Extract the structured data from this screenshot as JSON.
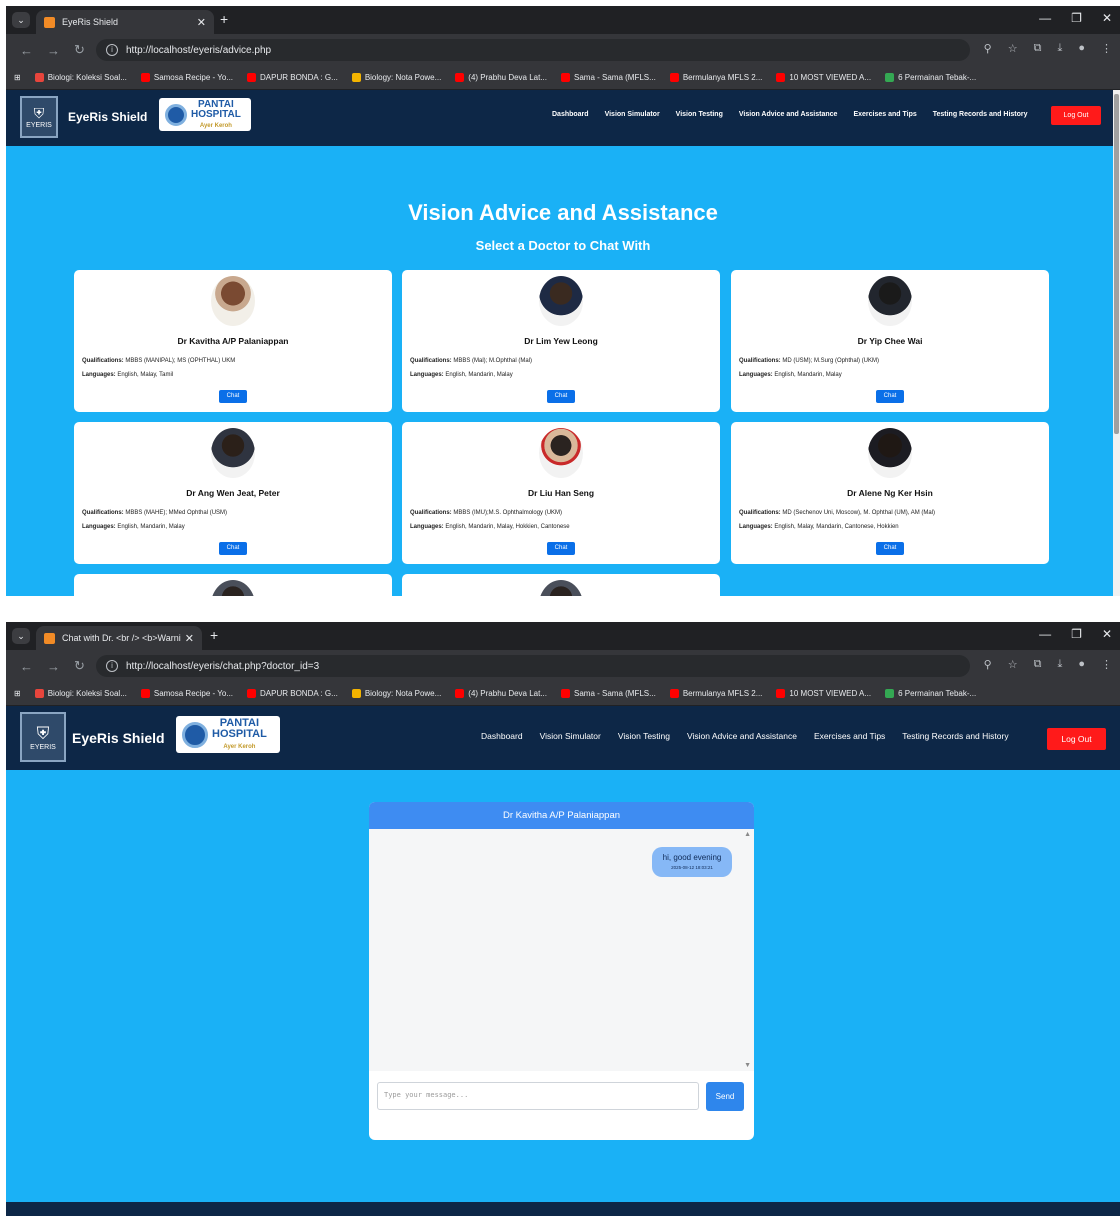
{
  "shot1": {
    "tab_title": "EyeRis Shield",
    "url": "http://localhost/eyeris/advice.php",
    "page_title": "Vision Advice and Assistance",
    "page_subtitle": "Select a Doctor to Chat With",
    "doctors": [
      {
        "name": "Dr Kavitha A/P Palaniappan",
        "qualifications": "MBBS (MANIPAL); MS (OPHTHAL) UKM",
        "languages": "English, Malay, Tamil"
      },
      {
        "name": "Dr Lim Yew Leong",
        "qualifications": "MBBS (Mal); M.Ophthal (Mal)",
        "languages": "English, Mandarin, Malay"
      },
      {
        "name": "Dr Yip Chee Wai",
        "qualifications": "MD (USM); M.Surg (Ophthal) (UKM)",
        "languages": "English, Mandarin, Malay"
      },
      {
        "name": "Dr Ang Wen Jeat, Peter",
        "qualifications": "MBBS (MAHE); MMed Ophthal (USM)",
        "languages": "English, Mandarin, Malay"
      },
      {
        "name": "Dr Liu Han Seng",
        "qualifications": "MBBS (IMU);M.S. Ophthalmology (UKM)",
        "languages": "English, Mandarin, Malay, Hokkien, Cantonese"
      },
      {
        "name": "Dr Alene Ng Ker Hsin",
        "qualifications": "MD (Sechenov Uni, Moscow), M. Ophthal (UM), AM (Mal)",
        "languages": "English, Malay, Mandarin, Cantonese, Hokkien"
      }
    ]
  },
  "shot2": {
    "tab_title": "Chat with Dr. <br /> <b>Warni",
    "url": "http://localhost/eyeris/chat.php?doctor_id=3",
    "chat_header": "Dr Kavitha A/P Palaniappan",
    "message_text": "hi, good evening",
    "message_time": "2025-08-12 18:03:21",
    "input_placeholder": "Type your message...",
    "send_label": "Send"
  },
  "common": {
    "brand": "EyeRis Shield",
    "logo_text": "EYERIS",
    "partner": {
      "line1": "PANTAI",
      "line2": "HOSPITAL",
      "line3": "Ayer Keroh"
    },
    "nav": [
      "Dashboard",
      "Vision Simulator",
      "Vision Testing",
      "Vision Advice and Assistance",
      "Exercises and Tips",
      "Testing Records and History"
    ],
    "logout": "Log Out",
    "qual_label": "Qualifications:",
    "lang_label": "Languages:",
    "chat_label": "Chat",
    "bookmarks": [
      "Biologi: Koleksi Soal...",
      "Samosa Recipe - Yo...",
      "DAPUR BONDA : G...",
      "Biology: Nota Powe...",
      "(4) Prabhu Deva Lat...",
      "Sama - Sama (MFLS...",
      "Bermulanya MFLS 2...",
      "10 MOST VIEWED A...",
      "6 Permainan Tebak-..."
    ],
    "colors": {
      "page_bg": "#1ab1f6",
      "navbar": "#0d2747",
      "logout": "#ff1a1a",
      "chat_btn": "#0a6fe8",
      "chat_header": "#3e8cf2"
    }
  }
}
